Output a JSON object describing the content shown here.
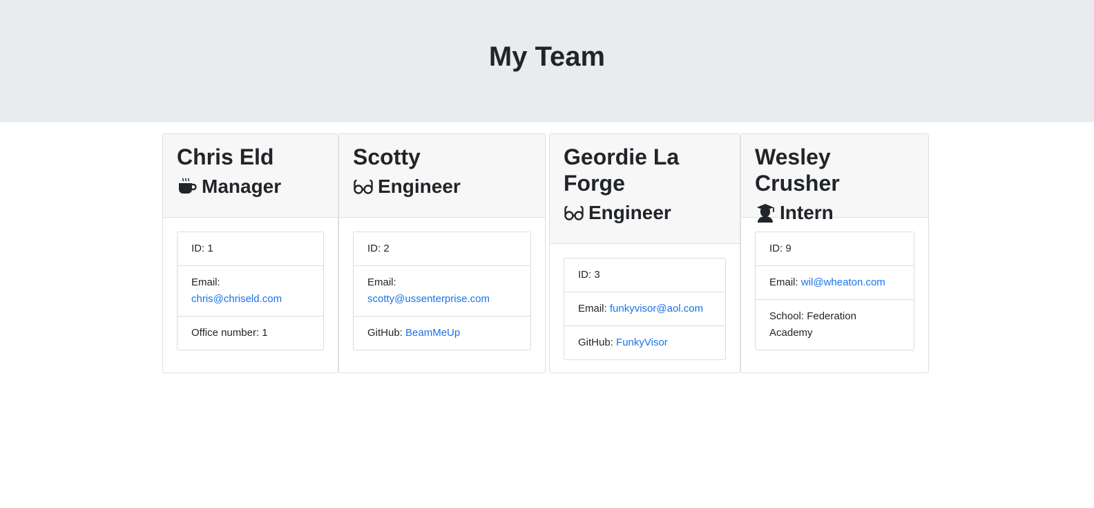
{
  "header": {
    "title": "My Team"
  },
  "colors": {
    "jumbotron_bg": "#e9ecef",
    "link": "#1a73e8",
    "card_header_bg": "#f7f7f7"
  },
  "employees": [
    {
      "name": "Chris Eld",
      "role": "Manager",
      "icon": "coffee-mug-icon",
      "id_label": "ID: 1",
      "email_label": "Email:",
      "email": "chris@chriseld.com",
      "extra_label": "Office number: 1",
      "extra_value": ""
    },
    {
      "name": "Scotty",
      "role": "Engineer",
      "icon": "glasses-icon",
      "id_label": "ID: 2",
      "email_label": "Email:",
      "email": "scotty@ussenterprise.com",
      "extra_label": "GitHub:",
      "extra_value": "BeamMeUp"
    },
    {
      "name": "Geordie La Forge",
      "role": "Engineer",
      "icon": "glasses-icon",
      "id_label": "ID: 3",
      "email_label": "Email:",
      "email": "funkyvisor@aol.com",
      "extra_label": "GitHub:",
      "extra_value": "FunkyVisor"
    },
    {
      "name": "Wesley Crusher",
      "role": "Intern",
      "icon": "graduate-icon",
      "id_label": "ID: 9",
      "email_label": "Email:",
      "email": "wil@wheaton.com",
      "extra_label": "School: Federation Academy",
      "extra_value": ""
    }
  ]
}
